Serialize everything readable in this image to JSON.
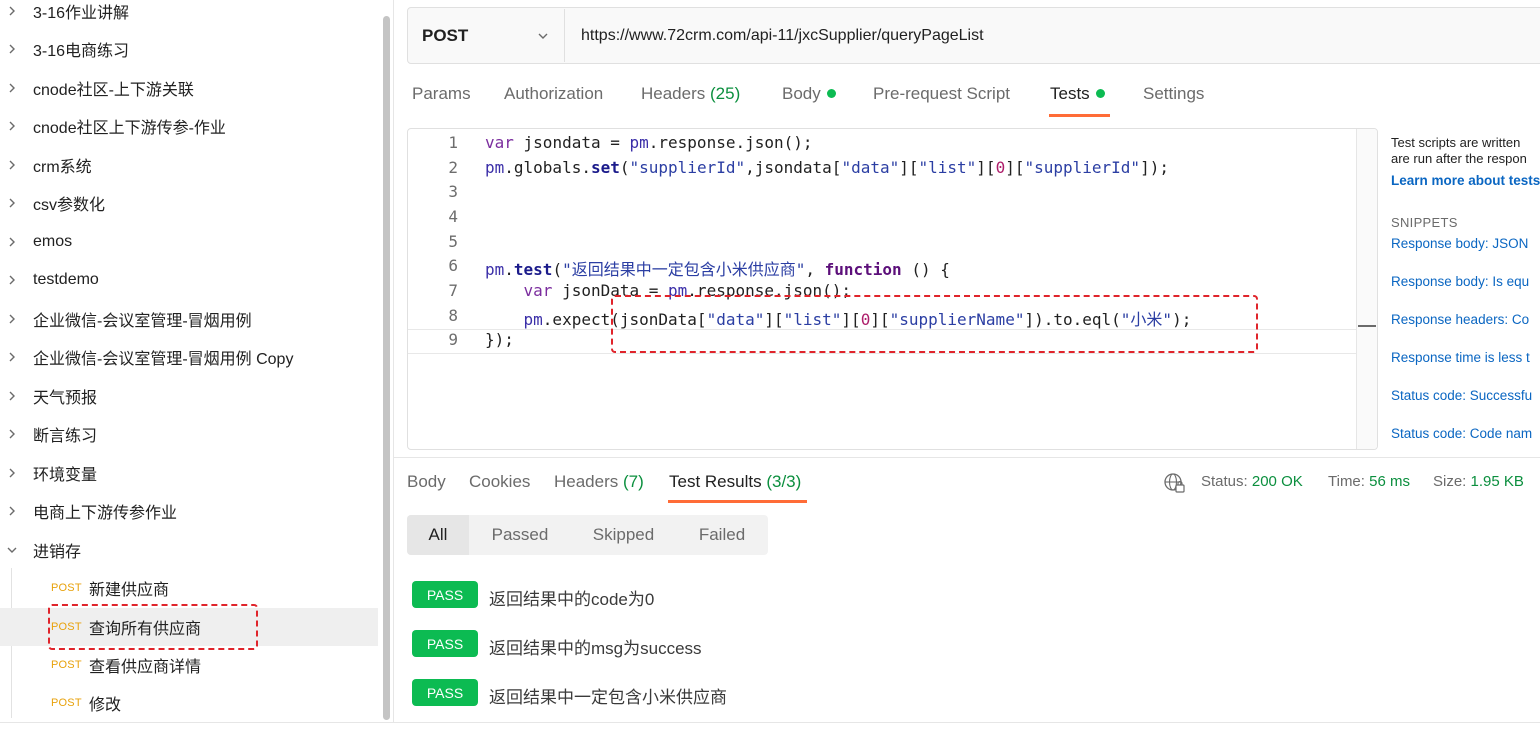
{
  "sidebar": {
    "folders": [
      {
        "label": "3-16作业讲解"
      },
      {
        "label": "3-16电商练习"
      },
      {
        "label": "cnode社区-上下游关联"
      },
      {
        "label": "cnode社区上下游传参-作业"
      },
      {
        "label": "crm系统"
      },
      {
        "label": "csv参数化"
      },
      {
        "label": "emos"
      },
      {
        "label": "testdemo"
      },
      {
        "label": "企业微信-会议室管理-冒烟用例"
      },
      {
        "label": "企业微信-会议室管理-冒烟用例 Copy"
      },
      {
        "label": "天气预报"
      },
      {
        "label": "断言练习"
      },
      {
        "label": "环境变量"
      },
      {
        "label": "电商上下游传参作业"
      },
      {
        "label": "进销存",
        "expanded": true
      }
    ],
    "requests": [
      {
        "method": "POST",
        "name": "新建供应商"
      },
      {
        "method": "POST",
        "name": "查询所有供应商",
        "active": true
      },
      {
        "method": "POST",
        "name": "查看供应商详情"
      },
      {
        "method": "POST",
        "name": "修改"
      }
    ]
  },
  "request": {
    "method": "POST",
    "url": "https://www.72crm.com/api-11/jxcSupplier/queryPageList"
  },
  "tabs": [
    {
      "label": "Params"
    },
    {
      "label": "Authorization"
    },
    {
      "label": "Headers",
      "count": "(25)"
    },
    {
      "label": "Body",
      "dot": true
    },
    {
      "label": "Pre-request Script"
    },
    {
      "label": "Tests",
      "dot": true,
      "active": true
    },
    {
      "label": "Settings"
    }
  ],
  "editor": {
    "line_numbers": [
      "1",
      "2",
      "3",
      "4",
      "5",
      "6",
      "7",
      "8",
      "9"
    ]
  },
  "snippets_panel": {
    "description_line1": "Test scripts are written",
    "description_line2": "are run after the respon",
    "learn_more": "Learn more about tests",
    "heading": "SNIPPETS",
    "items": [
      "Response body: JSON",
      "Response body: Is equ",
      "Response headers: Co",
      "Response time is less t",
      "Status code: Successfu",
      "Status code: Code nam"
    ]
  },
  "response": {
    "tabs": [
      {
        "label": "Body"
      },
      {
        "label": "Cookies"
      },
      {
        "label": "Headers",
        "count": "(7)"
      },
      {
        "label": "Test Results",
        "count": "(3/3)",
        "active": true
      }
    ],
    "status_label": "Status:",
    "status_value": "200 OK",
    "time_label": "Time:",
    "time_value": "56 ms",
    "size_label": "Size:",
    "size_value": "1.95 KB",
    "filters": [
      "All",
      "Passed",
      "Skipped",
      "Failed"
    ],
    "results": [
      {
        "badge": "PASS",
        "text": "返回结果中的code为0"
      },
      {
        "badge": "PASS",
        "text": "返回结果中的msg为success"
      },
      {
        "badge": "PASS",
        "text": "返回结果中一定包含小米供应商"
      }
    ]
  },
  "colors": {
    "accent": "#ff6c37",
    "pass_green": "#0cbb52",
    "method_orange": "#e8a20c",
    "annotation_red": "#e0242b",
    "link_blue": "#0a66c2"
  }
}
